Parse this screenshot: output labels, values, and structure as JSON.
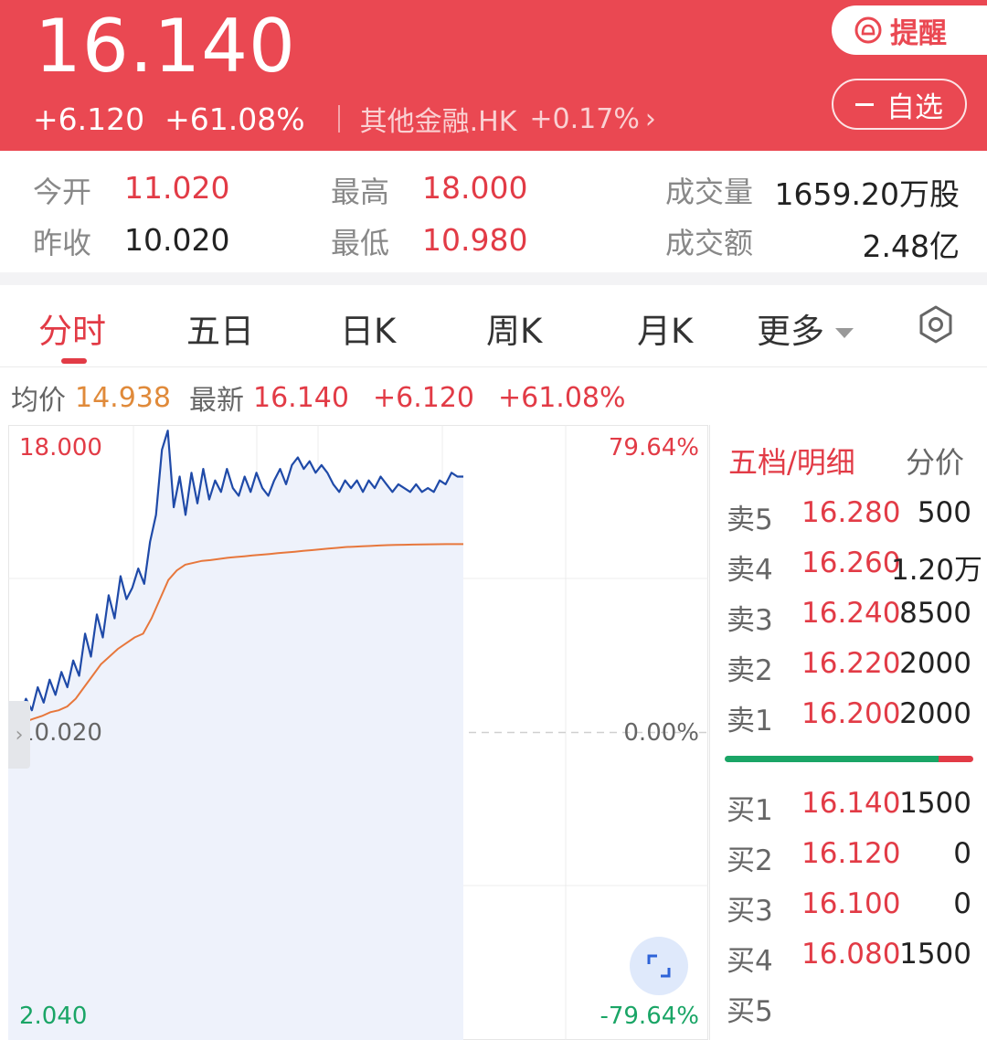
{
  "header": {
    "price": "16.140",
    "change": "+6.120",
    "change_pct": "+61.08%",
    "sector": "其他金融.HK",
    "sector_change": "+0.17%",
    "alert_label": "提醒",
    "watch_label": "自选",
    "bg_color": "#ea4852"
  },
  "stats": {
    "open_label": "今开",
    "open_value": "11.020",
    "high_label": "最高",
    "high_value": "18.000",
    "volume_label": "成交量",
    "volume_value": "1659.20万股",
    "prev_close_label": "昨收",
    "prev_close_value": "10.020",
    "low_label": "最低",
    "low_value": "10.980",
    "turnover_label": "成交额",
    "turnover_value": "2.48亿"
  },
  "tabs": [
    {
      "label": "分时",
      "active": true
    },
    {
      "label": "五日"
    },
    {
      "label": "日K"
    },
    {
      "label": "周K"
    },
    {
      "label": "月K"
    },
    {
      "label": "更多"
    }
  ],
  "info_line": {
    "avg_label": "均价",
    "avg_value": "14.938",
    "latest_label": "最新",
    "latest_value": "16.140",
    "change": "+6.120",
    "change_pct": "+61.08%"
  },
  "chart_data": {
    "type": "line",
    "y_top": "18.000",
    "y_mid": "10.020",
    "y_bottom": "2.040",
    "pct_top": "79.64%",
    "pct_mid": "0.00%",
    "pct_bottom": "-79.64%",
    "ylim": [
      2.04,
      18.0
    ],
    "baseline": 10.02,
    "series": [
      {
        "values": [
          10.3,
          10.7,
          10.45,
          10.9,
          10.6,
          11.2,
          10.8,
          11.4,
          11.0,
          11.6,
          11.2,
          11.9,
          11.5,
          12.6,
          12.0,
          13.1,
          12.5,
          13.6,
          13.0,
          14.1,
          13.5,
          13.8,
          14.3,
          13.9,
          15.0,
          15.7,
          17.4,
          17.9,
          15.9,
          16.7,
          15.7,
          16.8,
          16.0,
          16.9,
          16.1,
          16.6,
          16.3,
          16.9,
          16.4,
          16.2,
          16.7,
          16.3,
          16.8,
          16.4,
          16.2,
          16.6,
          16.9,
          16.5,
          17.0,
          17.2,
          16.9,
          17.1,
          16.8,
          17.0,
          16.8,
          16.5,
          16.3,
          16.6,
          16.4,
          16.6,
          16.3,
          16.6,
          16.4,
          16.7,
          16.5,
          16.3,
          16.5,
          16.4,
          16.3,
          16.5,
          16.3,
          16.4,
          16.3,
          16.6,
          16.5,
          16.8,
          16.7,
          16.7
        ]
      },
      {
        "values": [
          10.2,
          10.25,
          10.3,
          10.38,
          10.45,
          10.55,
          10.6,
          10.7,
          10.9,
          11.2,
          11.5,
          11.8,
          12.0,
          12.2,
          12.35,
          12.5,
          12.6,
          13.0,
          13.5,
          14.0,
          14.25,
          14.4,
          14.45,
          14.5,
          14.52,
          14.55,
          14.58,
          14.6,
          14.62,
          14.64,
          14.66,
          14.68,
          14.7,
          14.72,
          14.74,
          14.76,
          14.78,
          14.8,
          14.82,
          14.84,
          14.86,
          14.87,
          14.88,
          14.89,
          14.9,
          14.91,
          14.915,
          14.92,
          14.925,
          14.93,
          14.933,
          14.935,
          14.936,
          14.937,
          14.938
        ]
      }
    ],
    "colors": {
      "price": "#1f4aa8",
      "avg": "#e7773c",
      "fill": "#eef2fb"
    }
  },
  "order_book": {
    "title": "五档/明细",
    "alt_title": "分价",
    "asks": [
      {
        "label": "卖5",
        "price": "16.280",
        "qty": "500"
      },
      {
        "label": "卖4",
        "price": "16.260",
        "qty": "1.20万"
      },
      {
        "label": "卖3",
        "price": "16.240",
        "qty": "8500"
      },
      {
        "label": "卖2",
        "price": "16.220",
        "qty": "2000"
      },
      {
        "label": "卖1",
        "price": "16.200",
        "qty": "2000"
      }
    ],
    "bids": [
      {
        "label": "买1",
        "price": "16.140",
        "qty": "1500"
      },
      {
        "label": "买2",
        "price": "16.120",
        "qty": "0"
      },
      {
        "label": "买3",
        "price": "16.100",
        "qty": "0"
      },
      {
        "label": "买4",
        "price": "16.080",
        "qty": "1500"
      },
      {
        "label": "买5",
        "price": "",
        "qty": ""
      }
    ],
    "buy_ratio": 0.86
  }
}
